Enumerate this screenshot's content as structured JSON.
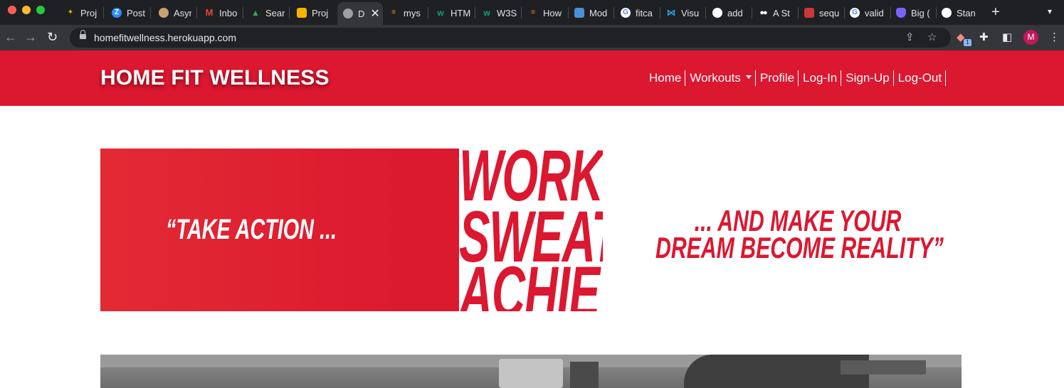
{
  "browser": {
    "tabs": [
      {
        "title": "Proj",
        "icon": "star-tools-icon",
        "color": "#f4b400"
      },
      {
        "title": "Post",
        "icon": "zoom-icon",
        "color": "#2d8cff"
      },
      {
        "title": "Asyr",
        "icon": "mascot-icon",
        "color": "#c8a26e"
      },
      {
        "title": "Inbo",
        "icon": "gmail-icon",
        "color": "#ea4335"
      },
      {
        "title": "Sear",
        "icon": "drive-icon",
        "color": "#34a853"
      },
      {
        "title": "Proj",
        "icon": "slides-icon",
        "color": "#f4b400"
      },
      {
        "title": "D",
        "icon": "globe-icon",
        "color": "#9aa0a6"
      },
      {
        "title": "mys",
        "icon": "stackoverflow-icon",
        "color": "#f48024"
      },
      {
        "title": "HTM",
        "icon": "w3schools-icon",
        "color": "#04aa6d"
      },
      {
        "title": "W3S",
        "icon": "w3schools-icon",
        "color": "#04aa6d"
      },
      {
        "title": "How",
        "icon": "stackoverflow-icon",
        "color": "#f48024"
      },
      {
        "title": "Mod",
        "icon": "cube-icon",
        "color": "#4a90d9"
      },
      {
        "title": "fitca",
        "icon": "google-icon",
        "color": "#4285f4"
      },
      {
        "title": "Visu",
        "icon": "vscode-icon",
        "color": "#23a9f2"
      },
      {
        "title": "add",
        "icon": "github-icon",
        "color": "#ffffff"
      },
      {
        "title": "A St",
        "icon": "medium-icon",
        "color": "#ffffff"
      },
      {
        "title": "sequ",
        "icon": "npm-icon",
        "color": "#cb3837"
      },
      {
        "title": "valid",
        "icon": "google-icon",
        "color": "#4285f4"
      },
      {
        "title": "Big (",
        "icon": "shield-icon",
        "color": "#7b61ff"
      },
      {
        "title": "Stan",
        "icon": "github-icon",
        "color": "#ffffff"
      }
    ],
    "url": "homefitwellness.herokuapp.com",
    "profile_initial": "M",
    "extension_badge": "1"
  },
  "site": {
    "brand": "HOME FIT WELLNESS",
    "nav": {
      "home": "Home",
      "workouts": "Workouts",
      "profile": "Profile",
      "login": "Log-In",
      "signup": "Sign-Up",
      "logout": "Log-Out"
    }
  },
  "hero": {
    "quote_left": "“TAKE ACTION ...",
    "words": [
      "WORK",
      "SWEAT",
      "ACHIEVE"
    ],
    "quote_right_1": "... AND MAKE YOUR",
    "quote_right_2": "DREAM BECOME REALITY”"
  },
  "colors": {
    "brand_red": "#dc1730",
    "chrome_dark": "#1f2023"
  }
}
